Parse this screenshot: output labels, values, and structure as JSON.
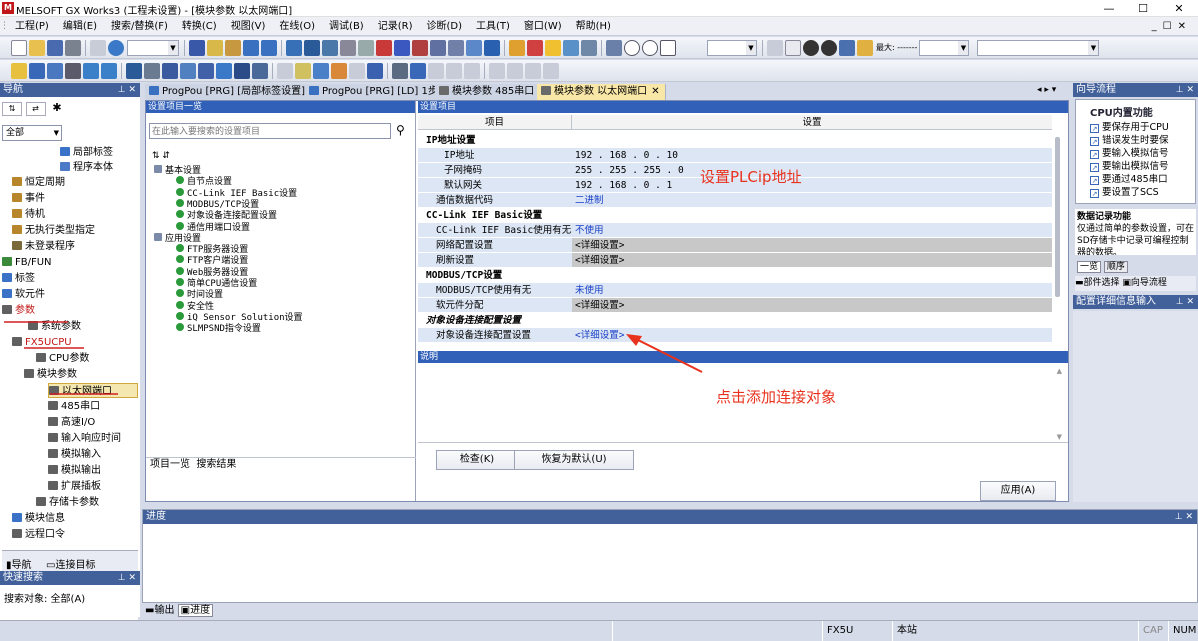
{
  "window": {
    "title": "MELSOFT GX Works3 (工程未设置) - [模块参数 以太网端口]",
    "logo": "M",
    "minimize": "—",
    "maximize": "☐",
    "close": "✕",
    "sub_min": "_",
    "sub_max": "☐",
    "sub_close": "✕"
  },
  "menu": [
    "工程(P)",
    "编辑(E)",
    "搜索/替换(F)",
    "转换(C)",
    "视图(V)",
    "在线(O)",
    "调试(B)",
    "记录(R)",
    "诊断(D)",
    "工具(T)",
    "窗口(W)",
    "帮助(H)"
  ],
  "toolbar": {
    "zoom_label": "最大: -------"
  },
  "nav": {
    "title": "导航",
    "view_combo": "全部",
    "items": [
      {
        "label": "局部标签",
        "color": "#3a72c8",
        "indent": 60
      },
      {
        "label": "程序本体",
        "color": "#4a7ac8",
        "indent": 60
      },
      {
        "label": "恒定周期",
        "color": "#b8862a",
        "indent": 12
      },
      {
        "label": "事件",
        "color": "#b8862a",
        "indent": 12
      },
      {
        "label": "待机",
        "color": "#b8862a",
        "indent": 12
      },
      {
        "label": "无执行类型指定",
        "color": "#b8862a",
        "indent": 12
      },
      {
        "label": "未登录程序",
        "color": "#7a6a3a",
        "indent": 12
      },
      {
        "label": "FB/FUN",
        "color": "#3a8a3a",
        "indent": 2
      },
      {
        "label": "标签",
        "color": "#3a72c8",
        "indent": 2
      },
      {
        "label": "软元件",
        "color": "#3a72c8",
        "indent": 2
      },
      {
        "label": "参数",
        "color": "#606060",
        "indent": 2
      },
      {
        "label": "系统参数",
        "color": "#606060",
        "indent": 28
      },
      {
        "label": "FX5UCPU",
        "color": "#606060",
        "indent": 12
      },
      {
        "label": "CPU参数",
        "color": "#606060",
        "indent": 36
      },
      {
        "label": "模块参数",
        "color": "#606060",
        "indent": 24
      },
      {
        "label": "以太网端口",
        "color": "#606060",
        "indent": 48
      },
      {
        "label": "485串口",
        "color": "#606060",
        "indent": 48
      },
      {
        "label": "高速I/O",
        "color": "#606060",
        "indent": 48
      },
      {
        "label": "输入响应时间",
        "color": "#606060",
        "indent": 48
      },
      {
        "label": "模拟输入",
        "color": "#606060",
        "indent": 48
      },
      {
        "label": "模拟输出",
        "color": "#606060",
        "indent": 48
      },
      {
        "label": "扩展插板",
        "color": "#606060",
        "indent": 48
      },
      {
        "label": "存储卡参数",
        "color": "#606060",
        "indent": 36
      },
      {
        "label": "模块信息",
        "color": "#3a72c8",
        "indent": 12
      },
      {
        "label": "远程口令",
        "color": "#606060",
        "indent": 12
      }
    ],
    "bottom_tabs": [
      "导航",
      "连接目标"
    ],
    "quick_search": {
      "title": "快速搜索",
      "scope": "搜索对象: 全部(A)"
    }
  },
  "tabs": [
    {
      "label": "ProgPou [PRG] [局部标签设置]",
      "active": false
    },
    {
      "label": "ProgPou [PRG] [LD] 1步",
      "active": false
    },
    {
      "label": "模块参数 485串口",
      "active": false
    },
    {
      "label": "模块参数 以太网端口",
      "active": true
    }
  ],
  "tab_close": "✕",
  "tab_nav": "◂ ▸ ▾",
  "settings_list": {
    "header": "设置项目一览",
    "search_placeholder": "在此输入要搜索的设置项目",
    "tree": [
      {
        "label": "基本设置",
        "level": 1
      },
      {
        "label": "自节点设置",
        "level": 2
      },
      {
        "label": "CC-Link IEF Basic设置",
        "level": 2
      },
      {
        "label": "MODBUS/TCP设置",
        "level": 2
      },
      {
        "label": "对象设备连接配置设置",
        "level": 2
      },
      {
        "label": "通信用端口设置",
        "level": 2
      },
      {
        "label": "应用设置",
        "level": 1
      },
      {
        "label": "FTP服务器设置",
        "level": 2
      },
      {
        "label": "FTP客户端设置",
        "level": 2
      },
      {
        "label": "Web服务器设置",
        "level": 2
      },
      {
        "label": "简单CPU通信设置",
        "level": 2
      },
      {
        "label": "时间设置",
        "level": 2
      },
      {
        "label": "安全性",
        "level": 2
      },
      {
        "label": "iQ Sensor Solution设置",
        "level": 2
      },
      {
        "label": "SLMPSND指令设置",
        "level": 2
      }
    ],
    "bottom_tabs": [
      "项目一览",
      "搜索结果"
    ]
  },
  "settings_grid": {
    "header": "设置项目",
    "col_item": "项目",
    "col_setting": "设置",
    "rows": [
      {
        "type": "group",
        "label": "IP地址设置"
      },
      {
        "type": "row",
        "label": "IP地址",
        "value": "192 . 168 .   0 .  10",
        "indent": 26,
        "shade": "light"
      },
      {
        "type": "row",
        "label": "子网掩码",
        "value": "255 . 255 . 255 .   0",
        "indent": 26,
        "shade": "light"
      },
      {
        "type": "row",
        "label": "默认网关",
        "value": "192 . 168 .   0 .   1",
        "indent": 26,
        "shade": "light"
      },
      {
        "type": "row",
        "label": "通信数据代码",
        "value": "二进制",
        "indent": 18,
        "shade": "light",
        "blue": true
      },
      {
        "type": "group",
        "label": "CC-Link IEF Basic设置"
      },
      {
        "type": "row",
        "label": "CC-Link IEF Basic使用有无",
        "value": "不使用",
        "indent": 18,
        "shade": "light",
        "blue": true
      },
      {
        "type": "row",
        "label": "网络配置设置",
        "value": "<详细设置>",
        "indent": 18,
        "shade": "gray"
      },
      {
        "type": "row",
        "label": "刷新设置",
        "value": "<详细设置>",
        "indent": 18,
        "shade": "gray"
      },
      {
        "type": "group",
        "label": "MODBUS/TCP设置"
      },
      {
        "type": "row",
        "label": "MODBUS/TCP使用有无",
        "value": "未使用",
        "indent": 18,
        "shade": "light",
        "blue": true
      },
      {
        "type": "row",
        "label": "软元件分配",
        "value": "<详细设置>",
        "indent": 18,
        "shade": "gray"
      },
      {
        "type": "group",
        "label": "对象设备连接配置设置",
        "italic": true
      },
      {
        "type": "row",
        "label": "对象设备连接配置设置",
        "value": "<详细设置>",
        "indent": 18,
        "shade": "light",
        "blue": true
      }
    ],
    "explain_header": "说明",
    "check_btn": "检查(K)",
    "restore_btn": "恢复为默认(U)",
    "apply_btn": "应用(A)"
  },
  "annotations": {
    "ip_note": "设置PLCip地址",
    "add_note": "点击添加连接对象"
  },
  "wizard": {
    "title": "向导流程",
    "group": "CPU内置功能",
    "items": [
      "要保存用于CPU",
      "错误发生时要保",
      "要输入模拟信号",
      "要输出模拟信号",
      "要通过485串口",
      "要设置了SCS"
    ],
    "desc_title": "数据记录功能",
    "desc_text": "仅通过简单的参数设置，可在SD存储卡中记录可编程控制器的数据。",
    "tabs": [
      "一览",
      "顺序"
    ],
    "bottom_tabs": [
      "部件选择",
      "向导流程"
    ],
    "detail_title": "配置详细信息输入"
  },
  "progress": {
    "title": "进度",
    "tabs": [
      "输出",
      "进度"
    ]
  },
  "status": {
    "cpu": "FX5U",
    "station": "本站",
    "caps": "CAP",
    "num": "NUM"
  }
}
